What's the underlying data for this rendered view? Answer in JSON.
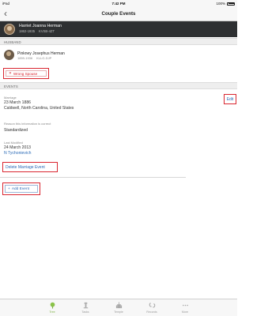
{
  "status_bar": {
    "carrier": "iPad",
    "time": "7:42 PM",
    "battery": "100%"
  },
  "nav": {
    "back_glyph": "‹",
    "title": "Couple Events"
  },
  "focus_person": {
    "name": "Harriet Joanna Herman",
    "years": "1862-1935",
    "pid": "KVSB-4ZT"
  },
  "husband_section": {
    "header": "HUSBAND"
  },
  "spouse": {
    "name": "Pinkney Josephus Herman",
    "years": "1859-1936",
    "pid": "KLLG-DJP"
  },
  "wrong_spouse_button": {
    "label": "Wrong Spouse"
  },
  "events_section": {
    "header": "EVENTS"
  },
  "marriage": {
    "label": "Marriage",
    "date": "23 March 1886",
    "place": "Caldwell, North Carolina, United States",
    "edit_label": "Edit"
  },
  "reason": {
    "label": "Reason this information is correct",
    "value": "Standardized"
  },
  "last_modified": {
    "label": "Last Modified",
    "date": "24 March 2013",
    "by": "N Tychonievich"
  },
  "delete_button": {
    "label": "Delete Marriage Event"
  },
  "add_event_button": {
    "label": "Add Event"
  },
  "tabs": [
    {
      "label": "Tree",
      "icon": "tree-icon",
      "active": true
    },
    {
      "label": "Tasks",
      "icon": "tasks-icon",
      "active": false
    },
    {
      "label": "Temple",
      "icon": "temple-icon",
      "active": false
    },
    {
      "label": "Records",
      "icon": "records-icon",
      "active": false
    },
    {
      "label": "More",
      "icon": "more-icon",
      "active": false
    }
  ],
  "colors": {
    "accent_red": "#d9252f",
    "link_blue": "#2a69b6",
    "active_tab": "#7cb342",
    "header_dark": "#2e3032"
  }
}
